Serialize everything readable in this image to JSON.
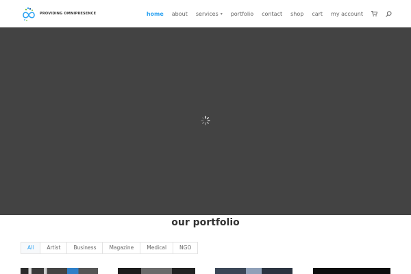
{
  "brand": {
    "tagline": "PROVIDING OMNIPRESENCE",
    "logo_colors": [
      "#2ea3f2",
      "#7ac142",
      "#1b5e9e"
    ]
  },
  "nav": {
    "items": [
      {
        "label": "home",
        "active": true
      },
      {
        "label": "about"
      },
      {
        "label": "services",
        "has_dropdown": true
      },
      {
        "label": "portfolio"
      },
      {
        "label": "contact"
      },
      {
        "label": "shop"
      },
      {
        "label": "cart"
      },
      {
        "label": "my account"
      }
    ],
    "cart_icon": "cart-icon",
    "search_icon": "search-icon"
  },
  "hero": {
    "background": "#434343",
    "loader_icon": "loading-spinner-icon"
  },
  "portfolio": {
    "title": "our portfolio",
    "filters": [
      {
        "label": "All",
        "active": true
      },
      {
        "label": "Artist"
      },
      {
        "label": "Business"
      },
      {
        "label": "Magazine"
      },
      {
        "label": "Medical"
      },
      {
        "label": "NGO"
      }
    ]
  },
  "colors": {
    "accent": "#2ea3f2",
    "hero_bg": "#434343"
  }
}
